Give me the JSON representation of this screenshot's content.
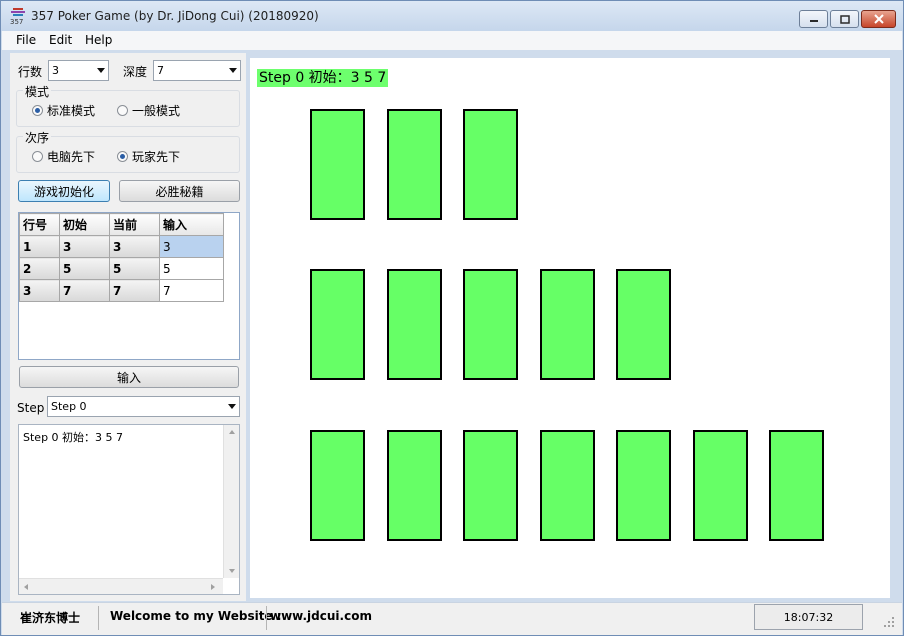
{
  "window": {
    "title": "357 Poker Game (by Dr. JiDong Cui) (20180920)",
    "icon_text": "357"
  },
  "menu": [
    "File",
    "Edit",
    "Help"
  ],
  "controls": {
    "rows_label": "行数",
    "rows_value": "3",
    "depth_label": "深度",
    "depth_value": "7",
    "mode_group": "模式",
    "mode_options": [
      "标准模式",
      "一般模式"
    ],
    "mode_selected": 0,
    "order_group": "次序",
    "order_options": [
      "电脑先下",
      "玩家先下"
    ],
    "order_selected": 1,
    "init_button": "游戏初始化",
    "secret_button": "必胜秘籍"
  },
  "table": {
    "headers": [
      "行号",
      "初始",
      "当前",
      "输入"
    ],
    "rows": [
      [
        "1",
        "3",
        "3",
        "3"
      ],
      [
        "2",
        "5",
        "5",
        "5"
      ],
      [
        "3",
        "7",
        "7",
        "7"
      ]
    ]
  },
  "input_button": "输入",
  "step": {
    "label": "Step",
    "value": "Step 0"
  },
  "log_text": "Step 0 初始：3 5 7",
  "board": {
    "step_text": "Step 0 初始：3 5 7",
    "rows": [
      3,
      5,
      7
    ],
    "card_color": "#66ff66"
  },
  "status": {
    "author": "崔济东博士",
    "welcome": "Welcome to my Website :",
    "website": "www.jdcui.com",
    "time": "18:07:32"
  }
}
